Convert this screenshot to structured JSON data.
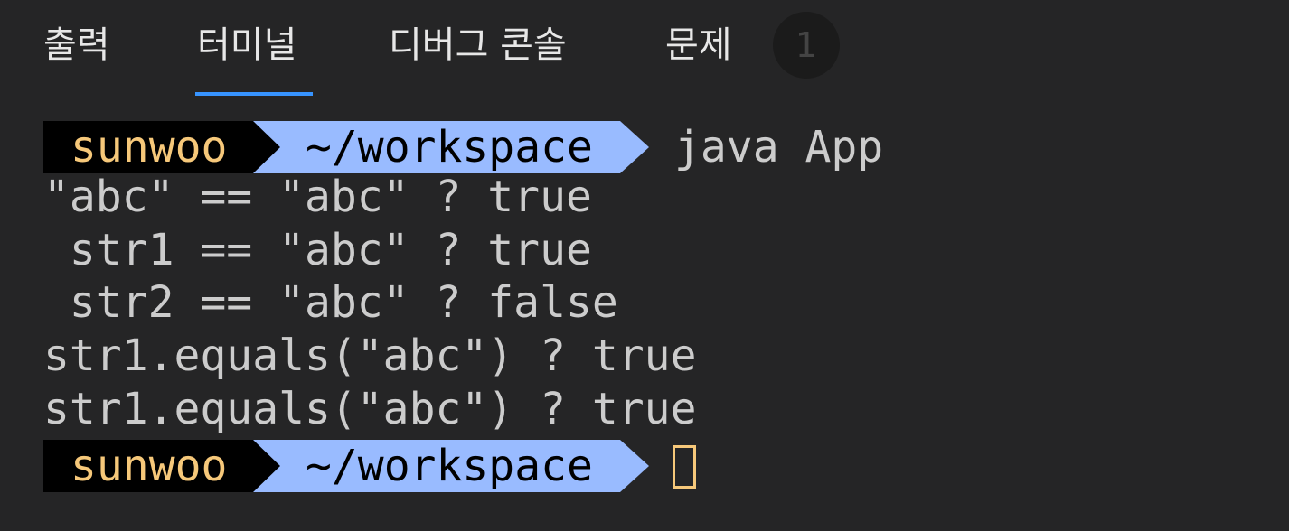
{
  "tabs": [
    {
      "label": "출력"
    },
    {
      "label": "터미널",
      "active": true
    },
    {
      "label": "디버그 콘솔"
    },
    {
      "label": "문제"
    }
  ],
  "problems_badge": "1",
  "colors": {
    "background": "#252526",
    "active_tab_underline": "#3794ff",
    "prompt_user_bg": "#000000",
    "prompt_user_fg": "#f6c87a",
    "prompt_path_bg": "#99bbff",
    "prompt_path_fg": "#000000",
    "output_fg": "#cccccc"
  },
  "terminal": {
    "prompt_user": "sunwoo",
    "prompt_path": "~/workspace",
    "command": "java App",
    "output": [
      "\"abc\" == \"abc\" ? true",
      " str1 == \"abc\" ? true",
      " str2 == \"abc\" ? false",
      "str1.equals(\"abc\") ? true",
      "str1.equals(\"abc\") ? true"
    ]
  }
}
